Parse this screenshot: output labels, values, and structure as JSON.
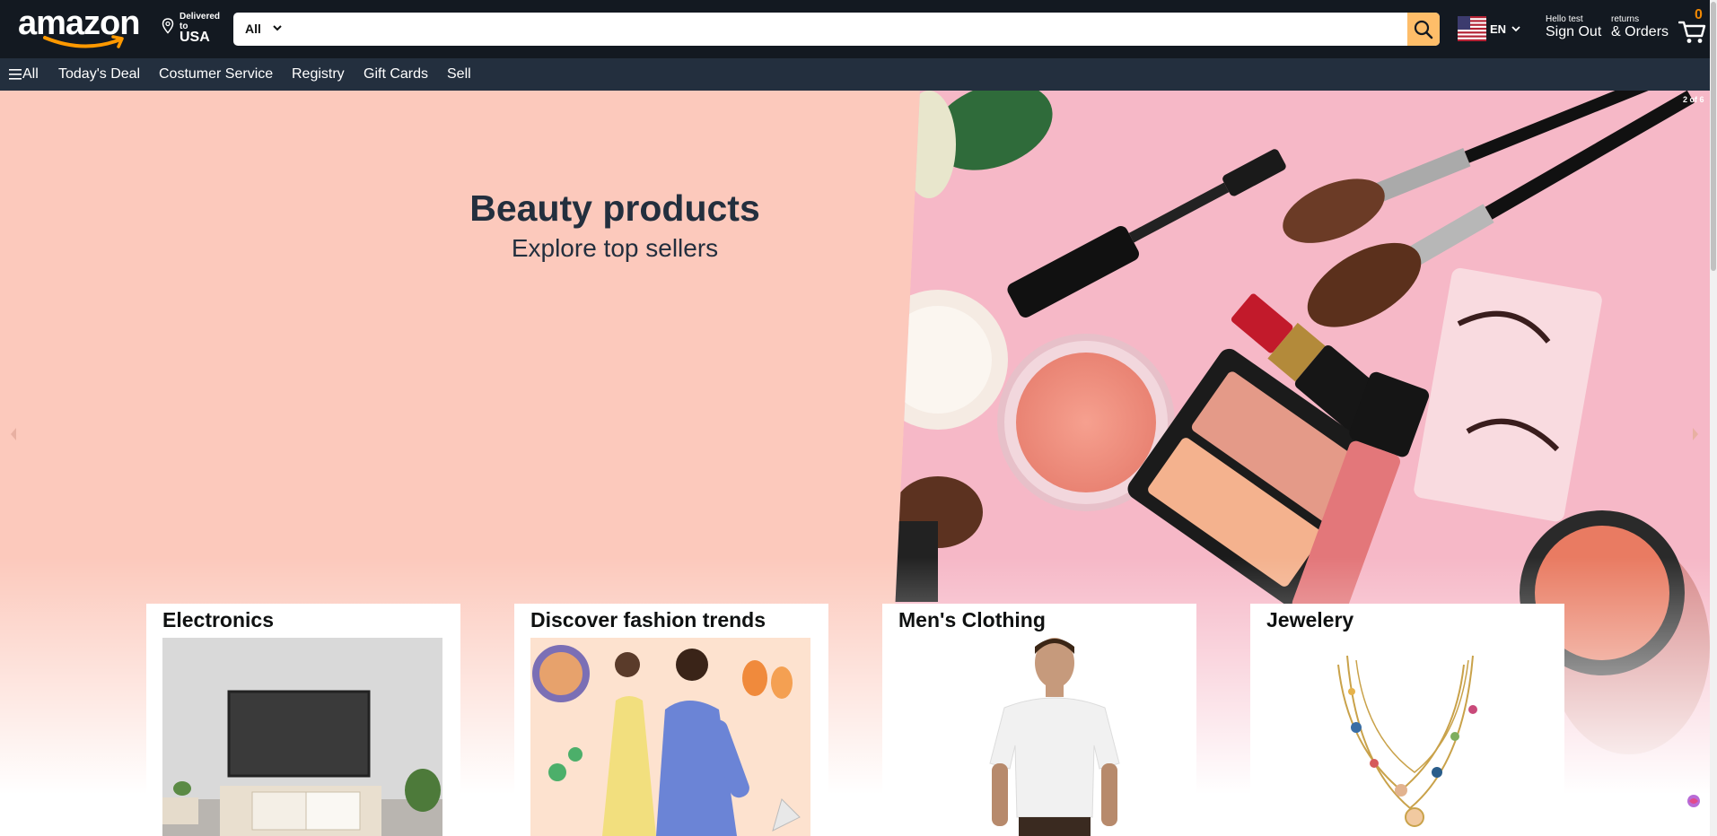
{
  "header": {
    "logo_text": "amazon",
    "deliver_small": "Delivered to",
    "deliver_country": "USA",
    "search_category": "All",
    "search_placeholder": "",
    "language": "EN",
    "account_small": "Hello test",
    "account_big": "Sign Out",
    "orders_small": "returns",
    "orders_big": "& Orders",
    "cart_count": "0"
  },
  "nav": {
    "all": "All",
    "items": [
      "Today's Deal",
      "Costumer Service",
      "Registry",
      "Gift Cards",
      "Sell"
    ]
  },
  "hero": {
    "title": "Beauty products",
    "subtitle": "Explore top sellers",
    "counter": "2 of 6"
  },
  "cards": [
    {
      "title": "Electronics"
    },
    {
      "title": "Discover fashion trends"
    },
    {
      "title": "Men's Clothing"
    },
    {
      "title": "Jewelery"
    }
  ],
  "colors": {
    "header_bg": "#131921",
    "nav_bg": "#232f3e",
    "search_button": "#febd69",
    "cart_count": "#f08804",
    "hero_bg": "#fcc9bc"
  },
  "icons": [
    "location-pin-icon",
    "chevron-down-icon",
    "search-icon",
    "us-flag-icon",
    "cart-icon",
    "hamburger-menu-icon",
    "arrow-left-icon",
    "arrow-right-icon"
  ]
}
